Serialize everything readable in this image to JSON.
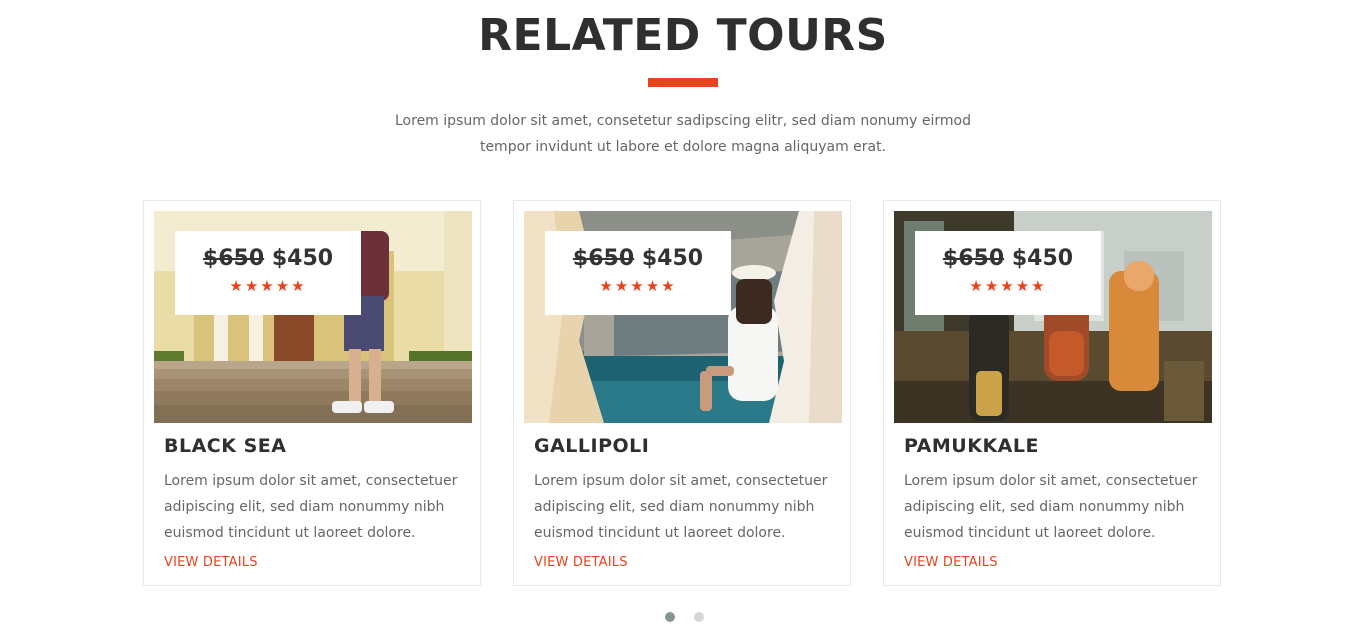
{
  "section": {
    "title": "RELATED TOURS",
    "intro": "Lorem ipsum dolor sit amet, consetetur sadipscing elitr, sed diam nonumy eirmod tempor invidunt ut labore et dolore magna aliquyam erat.",
    "accent_color": "#e8441b"
  },
  "tours": [
    {
      "name": "BLACK SEA",
      "old_price": "$650",
      "new_price": "$450",
      "stars": "★★★★★",
      "rating": 5,
      "description": "Lorem ipsum dolor sit amet, consectetuer adipiscing elit, sed diam nonummy nibh euismod tincidunt ut laoreet dolore.",
      "link_label": "VIEW DETAILS"
    },
    {
      "name": "GALLIPOLI",
      "old_price": "$650",
      "new_price": "$450",
      "stars": "★★★★★",
      "rating": 5,
      "description": "Lorem ipsum dolor sit amet, consectetuer adipiscing elit, sed diam nonummy nibh euismod tincidunt ut laoreet dolore.",
      "link_label": "VIEW DETAILS"
    },
    {
      "name": "PAMUKKALE",
      "old_price": "$650",
      "new_price": "$450",
      "stars": "★★★★★",
      "rating": 5,
      "description": "Lorem ipsum dolor sit amet, consectetuer adipiscing elit, sed diam nonummy nibh euismod tincidunt ut laoreet dolore.",
      "link_label": "VIEW DETAILS"
    }
  ],
  "carousel": {
    "pages": 2,
    "active_page": 1
  }
}
